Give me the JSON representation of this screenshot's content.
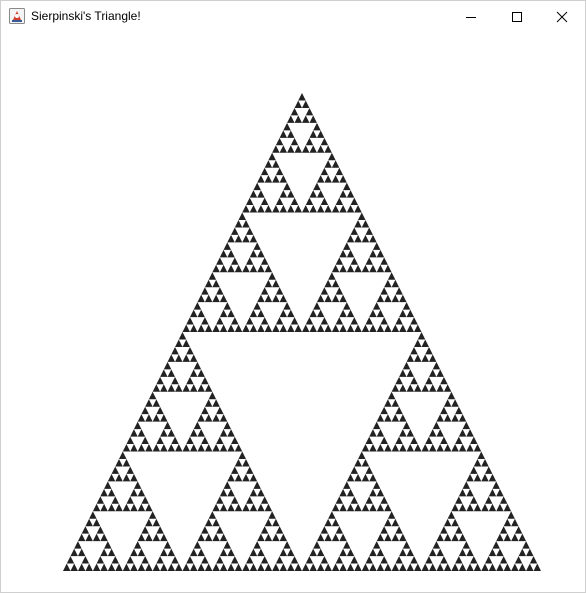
{
  "window": {
    "title": "Sierpinski's Triangle!",
    "app_icon": "java-duke-icon",
    "controls": {
      "minimize_icon": "minimize-icon",
      "maximize_icon": "maximize-icon",
      "close_icon": "close-icon"
    }
  },
  "fractal": {
    "shape": "sierpinski-triangle",
    "recursion_depth": 6,
    "fill_color": "#222222",
    "background_color": "#ffffff"
  }
}
